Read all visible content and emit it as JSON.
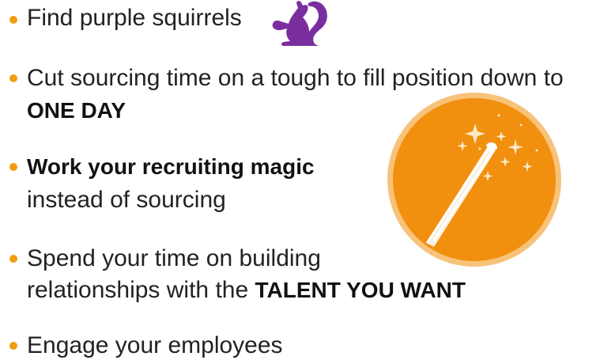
{
  "bullets": [
    {
      "text": "Find purple squirrels"
    },
    {
      "line1": "Cut sourcing time on a tough to fill position down to",
      "line2_bold": "ONE DAY"
    },
    {
      "line1_bold": "Work your recruiting magic",
      "line2": "instead of sourcing"
    },
    {
      "line1": "Spend your time on building",
      "line2_prefix": "relationships with the ",
      "line2_bold": "TALENT YOU WANT"
    },
    {
      "text": "Engage your employees"
    }
  ],
  "colors": {
    "bullet": "#f39c12",
    "squirrel": "#7b2f9e",
    "badge_fill": "#f18f0f",
    "badge_ring": "#f9c27a"
  },
  "icons": {
    "squirrel": "purple-squirrel-icon",
    "wand": "magic-wand-icon"
  }
}
